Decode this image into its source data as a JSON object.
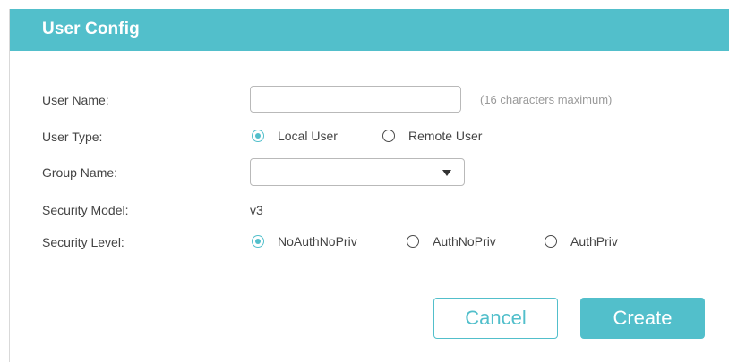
{
  "header": {
    "title": "User Config"
  },
  "form": {
    "user_name": {
      "label": "User Name:",
      "value": "",
      "hint": "(16 characters maximum)"
    },
    "user_type": {
      "label": "User Type:",
      "options": [
        {
          "label": "Local User",
          "checked": true
        },
        {
          "label": "Remote User",
          "checked": false
        }
      ]
    },
    "group_name": {
      "label": "Group Name:",
      "selected": ""
    },
    "security_model": {
      "label": "Security Model:",
      "value": "v3"
    },
    "security_level": {
      "label": "Security Level:",
      "options": [
        {
          "label": "NoAuthNoPriv",
          "checked": true
        },
        {
          "label": "AuthNoPriv",
          "checked": false
        },
        {
          "label": "AuthPriv",
          "checked": false
        }
      ]
    }
  },
  "actions": {
    "cancel_label": "Cancel",
    "create_label": "Create"
  },
  "colors": {
    "accent": "#52bfcb",
    "text": "#444444",
    "hint": "#9a9a9a"
  },
  "icons": {
    "dropdown": "triangle-down-icon"
  }
}
